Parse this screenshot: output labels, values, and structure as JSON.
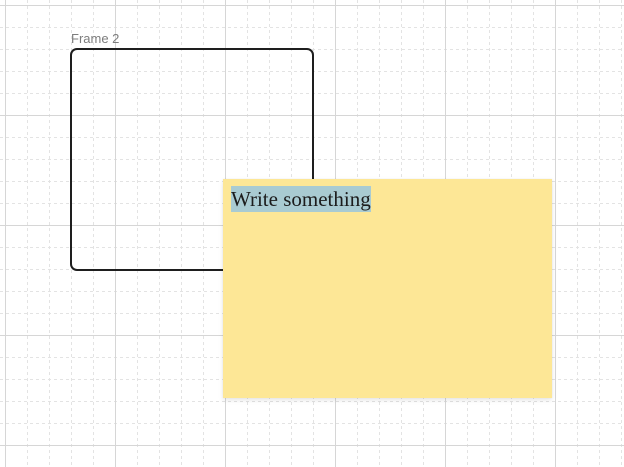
{
  "canvas": {
    "background_color": "#ffffff",
    "grid_major_color": "#d6d6d6",
    "grid_minor_color": "#e3e3e3"
  },
  "frame": {
    "label": "Frame 2",
    "border_color": "#1e1e1e"
  },
  "sticky_note": {
    "text": "Write something",
    "background_color": "#fde796",
    "selection_color": "#a9cbd2"
  }
}
